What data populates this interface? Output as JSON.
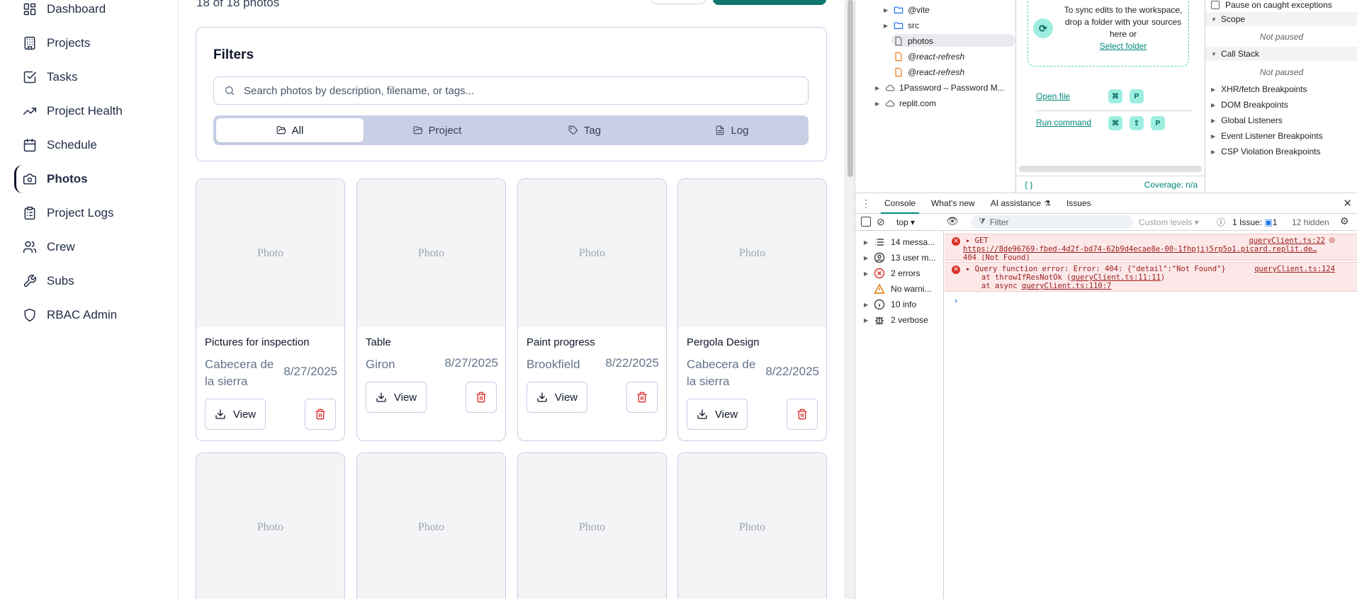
{
  "sidebar": {
    "items": [
      {
        "label": "Dashboard",
        "icon": "layout-grid-icon"
      },
      {
        "label": "Projects",
        "icon": "building-icon"
      },
      {
        "label": "Tasks",
        "icon": "check-square-icon"
      },
      {
        "label": "Project Health",
        "icon": "trending-up-icon"
      },
      {
        "label": "Schedule",
        "icon": "calendar-icon"
      },
      {
        "label": "Photos",
        "icon": "camera-icon"
      },
      {
        "label": "Project Logs",
        "icon": "clipboard-icon"
      },
      {
        "label": "Crew",
        "icon": "users-icon"
      },
      {
        "label": "Subs",
        "icon": "wrench-icon"
      },
      {
        "label": "RBAC Admin",
        "icon": "shield-icon"
      }
    ],
    "active": "Photos"
  },
  "main": {
    "count_text": "18 of 18 photos",
    "filters": {
      "title": "Filters",
      "search_placeholder": "Search photos by description, filename, or tags...",
      "tabs": [
        "All",
        "Project",
        "Tag",
        "Log"
      ],
      "active_tab": "All"
    },
    "photo_placeholder": "Photo",
    "view_label": "View",
    "cards": [
      {
        "title": "Pictures for inspection",
        "location": "Cabecera de la sierra",
        "date": "8/27/2025"
      },
      {
        "title": "Table",
        "location": "Giron",
        "date": "8/27/2025"
      },
      {
        "title": "Paint progress",
        "location": "Brookfield",
        "date": "8/22/2025"
      },
      {
        "title": "Pergola Design",
        "location": "Cabecera de la sierra",
        "date": "8/22/2025"
      }
    ]
  },
  "devtools": {
    "tree": [
      {
        "label": "@vite",
        "type": "folder"
      },
      {
        "label": "src",
        "type": "folder"
      },
      {
        "label": "photos",
        "type": "file",
        "selected": true
      },
      {
        "label": "@react-refresh",
        "type": "js"
      },
      {
        "label": "@react-refresh",
        "type": "js"
      },
      {
        "label": "1Password – Password M...",
        "type": "cloud"
      },
      {
        "label": "replit.com",
        "type": "cloud"
      }
    ],
    "workspace": {
      "text": "To sync edits to the workspace, drop a folder with your sources here or",
      "link": "Select folder",
      "open_file": "Open file",
      "run_command": "Run command",
      "open_file_keys": [
        "⌘",
        "P"
      ],
      "run_command_keys": [
        "⌘",
        "⇧",
        "P"
      ],
      "braces": "{ }",
      "coverage": "Coverage: n/a"
    },
    "debugger": {
      "pause_caught": "Pause on caught exceptions",
      "scope": "Scope",
      "scope_status": "Not paused",
      "call_stack": "Call Stack",
      "call_stack_status": "Not paused",
      "breakpoints": [
        "XHR/fetch Breakpoints",
        "DOM Breakpoints",
        "Global Listeners",
        "Event Listener Breakpoints",
        "CSP Violation Breakpoints"
      ]
    },
    "drawer_tabs": [
      "Console",
      "What's new",
      "AI assistance",
      "Issues"
    ],
    "active_drawer_tab": "Console",
    "toolbar": {
      "context": "top",
      "filter_placeholder": "Filter",
      "levels": "Custom levels",
      "issues": "1 Issue:",
      "issues_count": "1",
      "hidden": "12 hidden"
    },
    "console_sidebar": [
      {
        "label": "14 messa...",
        "icon": "list-icon"
      },
      {
        "label": "13 user m...",
        "icon": "user-icon"
      },
      {
        "label": "2 errors",
        "icon": "error-icon"
      },
      {
        "label": "No warni...",
        "icon": "warning-icon"
      },
      {
        "label": "10 info",
        "icon": "info-icon"
      },
      {
        "label": "2 verbose",
        "icon": "bug-icon"
      }
    ],
    "logs": {
      "get_method": "GET",
      "get_source": "queryClient.ts:22",
      "get_url": "https://8de96769-fbed-4d2f-bd74-62b9d4ecae8e-00-1fhpjij5rp5o1.picard.replit.de…",
      "get_status": "404 (Not Found)",
      "err_text": "Query function error: Error: 404: {\"detail\":\"Not Found\"}",
      "err_source": "queryClient.ts:124",
      "stack1_prefix": "at throwIfResNotOk (",
      "stack1_link": "queryClient.ts:11:11",
      "stack1_suffix": ")",
      "stack2_prefix": "at async ",
      "stack2_link": "queryClient.ts:110:7",
      "prompt": "›"
    }
  }
}
